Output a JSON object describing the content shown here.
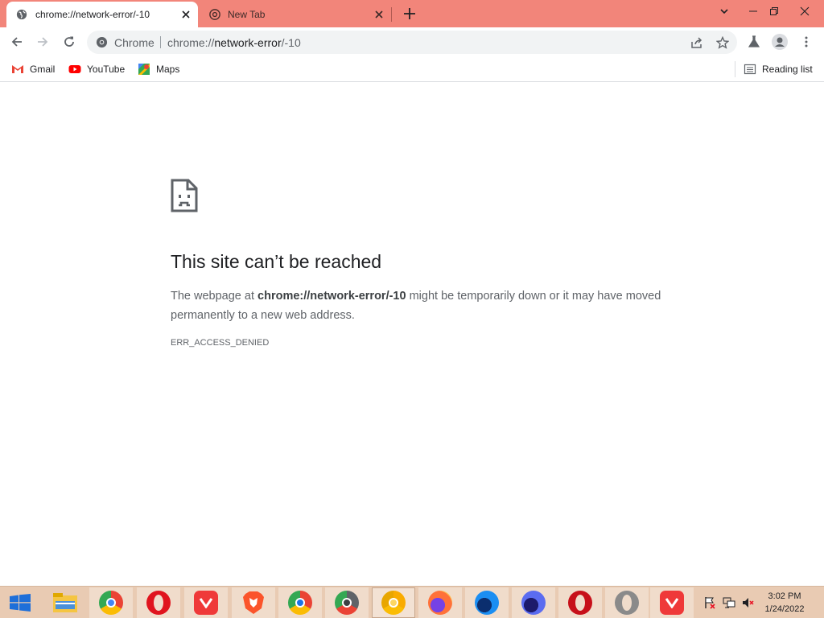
{
  "tabs": [
    {
      "title": "chrome://network-error/-10",
      "active": true
    },
    {
      "title": "New Tab",
      "active": false
    }
  ],
  "address_bar": {
    "site_chip": "Chrome",
    "url_scheme": "chrome://",
    "url_host": "network-error",
    "url_path": "/-10"
  },
  "bookmarks": [
    {
      "label": "Gmail",
      "icon": "gmail-icon"
    },
    {
      "label": "YouTube",
      "icon": "youtube-icon"
    },
    {
      "label": "Maps",
      "icon": "maps-icon"
    }
  ],
  "reading_list": {
    "label": "Reading list"
  },
  "error_page": {
    "title": "This site can’t be reached",
    "message_prefix": "The webpage at ",
    "message_url": "chrome://network-error/-10",
    "message_suffix": " might be temporarily down or it may have moved permanently to a new web address.",
    "code": "ERR_ACCESS_DENIED"
  },
  "taskbar": {
    "apps": [
      {
        "name": "File Explorer",
        "icon": "file-explorer-icon"
      },
      {
        "name": "Chrome",
        "icon": "chrome-icon"
      },
      {
        "name": "Opera",
        "icon": "opera-icon"
      },
      {
        "name": "Vivaldi",
        "icon": "vivaldi-icon"
      },
      {
        "name": "Brave",
        "icon": "brave-icon"
      },
      {
        "name": "Chrome Beta",
        "icon": "chrome-beta-icon"
      },
      {
        "name": "Chrome Dev",
        "icon": "chrome-dev-icon"
      },
      {
        "name": "Chrome Canary",
        "icon": "chrome-canary-icon"
      },
      {
        "name": "Firefox",
        "icon": "firefox-icon"
      },
      {
        "name": "Firefox Developer",
        "icon": "firefox-dev-icon"
      },
      {
        "name": "Firefox Nightly",
        "icon": "firefox-nightly-icon"
      },
      {
        "name": "Opera GX",
        "icon": "opera-gx-icon"
      },
      {
        "name": "Opera Beta",
        "icon": "opera-beta-icon"
      },
      {
        "name": "Vivaldi Snapshot",
        "icon": "vivaldi-snapshot-icon"
      }
    ],
    "clock_time": "3:02 PM",
    "clock_date": "1/24/2022"
  },
  "colors": {
    "titlebar": "#f2857a",
    "taskbar": "#e9cbb3",
    "error_text": "#5f6368"
  }
}
